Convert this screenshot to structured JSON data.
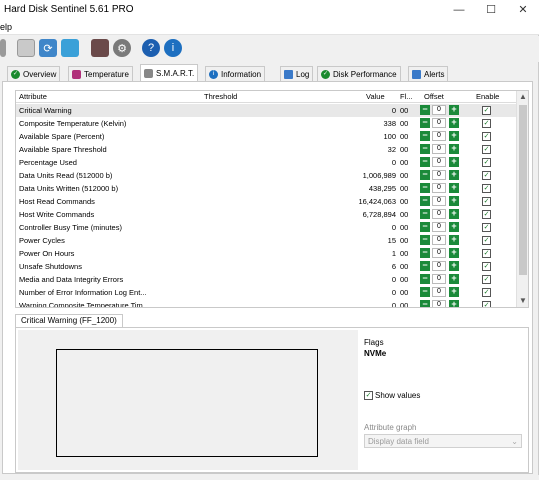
{
  "window": {
    "title": "Hard Disk Sentinel 5.61 PRO",
    "minimize_glyph": "—",
    "maximize_glyph": "☐",
    "close_glyph": "✕"
  },
  "menu": {
    "help_label": "elp"
  },
  "toolbar": {
    "icons": [
      "arrow-icon",
      "report-icon",
      "refresh-icon",
      "network-icon",
      "disk-tool-icon",
      "settings-icon",
      "help-icon",
      "info-icon"
    ]
  },
  "tabs": [
    {
      "label": "Overview",
      "icon": "check-circle-icon"
    },
    {
      "label": "Temperature",
      "icon": "thermometer-icon"
    },
    {
      "label": "S.M.A.R.T.",
      "icon": "disk-icon"
    },
    {
      "label": "Information",
      "icon": "info-icon"
    },
    {
      "label": "Log",
      "icon": "log-icon"
    },
    {
      "label": "Disk Performance",
      "icon": "check-circle-icon"
    },
    {
      "label": "Alerts",
      "icon": "alerts-icon"
    }
  ],
  "active_tab": "S.M.A.R.T.",
  "smart": {
    "headers": {
      "attribute": "Attribute",
      "threshold": "Threshold",
      "value": "Value",
      "flags": "Fl...",
      "offset": "Offset",
      "enable": "Enable"
    },
    "rows": [
      {
        "attribute": "Critical Warning",
        "value": "0",
        "flags": "00",
        "offset": "0",
        "enabled": true
      },
      {
        "attribute": "Composite Temperature (Kelvin)",
        "value": "338",
        "flags": "00",
        "offset": "0",
        "enabled": true
      },
      {
        "attribute": "Available Spare (Percent)",
        "value": "100",
        "flags": "00",
        "offset": "0",
        "enabled": true
      },
      {
        "attribute": "Available Spare Threshold",
        "value": "32",
        "flags": "00",
        "offset": "0",
        "enabled": true
      },
      {
        "attribute": "Percentage Used",
        "value": "0",
        "flags": "00",
        "offset": "0",
        "enabled": true
      },
      {
        "attribute": "Data Units Read (512000 b)",
        "value": "1,006,989",
        "flags": "00",
        "offset": "0",
        "enabled": true
      },
      {
        "attribute": "Data Units Written (512000 b)",
        "value": "438,295",
        "flags": "00",
        "offset": "0",
        "enabled": true
      },
      {
        "attribute": "Host Read Commands",
        "value": "16,424,063",
        "flags": "00",
        "offset": "0",
        "enabled": true
      },
      {
        "attribute": "Host Write Commands",
        "value": "6,728,894",
        "flags": "00",
        "offset": "0",
        "enabled": true
      },
      {
        "attribute": "Controller Busy Time (minutes)",
        "value": "0",
        "flags": "00",
        "offset": "0",
        "enabled": true
      },
      {
        "attribute": "Power Cycles",
        "value": "15",
        "flags": "00",
        "offset": "0",
        "enabled": true
      },
      {
        "attribute": "Power On Hours",
        "value": "1",
        "flags": "00",
        "offset": "0",
        "enabled": true
      },
      {
        "attribute": "Unsafe Shutdowns",
        "value": "6",
        "flags": "00",
        "offset": "0",
        "enabled": true
      },
      {
        "attribute": "Media and Data Integrity Errors",
        "value": "0",
        "flags": "00",
        "offset": "0",
        "enabled": true
      },
      {
        "attribute": "Number of Error Information Log Ent...",
        "value": "0",
        "flags": "00",
        "offset": "0",
        "enabled": true
      },
      {
        "attribute": "Warning Composite Temperature Tim...",
        "value": "0",
        "flags": "00",
        "offset": "0",
        "enabled": true
      }
    ],
    "selected_row": "Critical Warning"
  },
  "detail": {
    "tab_label": "Critical Warning (FF_1200)",
    "flags_label": "Flags",
    "flags_value": "NVMe",
    "show_values_label": "Show values",
    "show_values_checked": true,
    "attribute_graph_label": "Attribute graph",
    "attribute_graph_select": "Display data field"
  }
}
